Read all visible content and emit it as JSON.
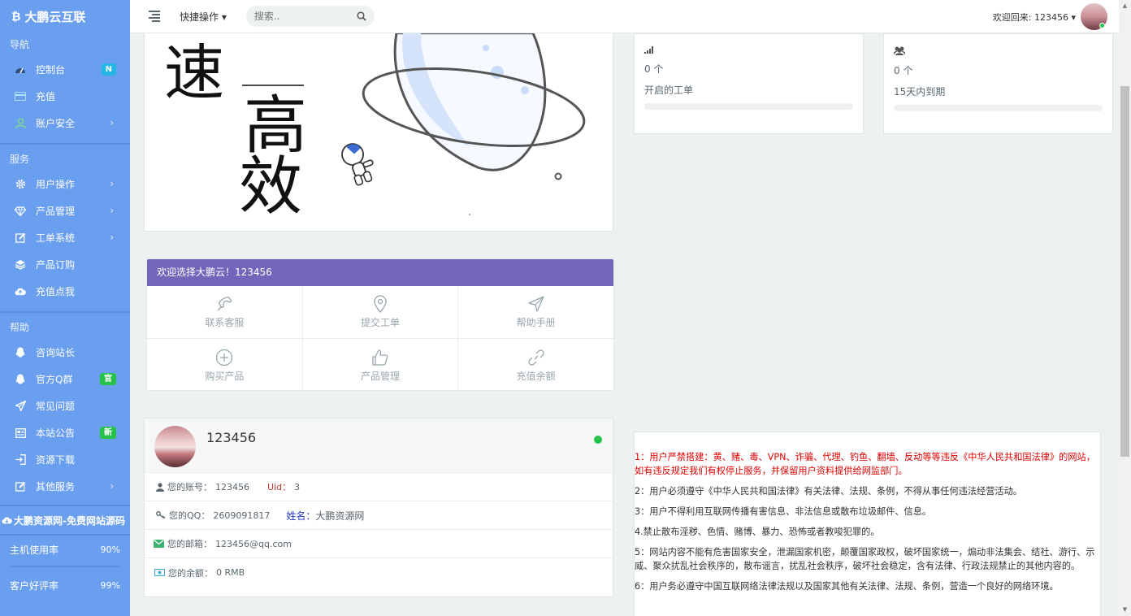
{
  "brand": {
    "logo_icon": "bitcoin-icon",
    "name": "大鹏云互联"
  },
  "sidebar": {
    "sections": [
      {
        "title": "导航",
        "items": [
          {
            "label": "控制台",
            "icon": "dashboard-icon",
            "badge": "N"
          },
          {
            "label": "充值",
            "icon": "card-icon"
          },
          {
            "label": "账户安全",
            "icon": "user-icon",
            "arrow": "›"
          }
        ]
      },
      {
        "title": "服务",
        "items": [
          {
            "label": "用户操作",
            "icon": "gear-icon",
            "arrow": "›"
          },
          {
            "label": "产品管理",
            "icon": "diamond-icon",
            "arrow": "›"
          },
          {
            "label": "工单系统",
            "icon": "edit-icon",
            "arrow": "›"
          },
          {
            "label": "产品订购",
            "icon": "layers-icon"
          },
          {
            "label": "充值点我",
            "icon": "cloud-upload-icon"
          }
        ]
      },
      {
        "title": "帮助",
        "items": [
          {
            "label": "咨询站长",
            "icon": "penguin-icon"
          },
          {
            "label": "官方Q群",
            "icon": "penguin-icon",
            "badge": "官"
          },
          {
            "label": "常见问题",
            "icon": "send-icon"
          },
          {
            "label": "本站公告",
            "icon": "news-icon",
            "badge": "新"
          },
          {
            "label": "资源下载",
            "icon": "sign-in-icon"
          },
          {
            "label": "其他服务",
            "icon": "edit-icon",
            "arrow": "›"
          }
        ]
      }
    ],
    "promo": {
      "label": "大鹏资源网-免费网站源码",
      "icon": "cloud-download-icon"
    },
    "stats": [
      {
        "label": "主机使用率",
        "value": "90%"
      },
      {
        "label": "客户好评率",
        "value": "99%"
      }
    ]
  },
  "header": {
    "quick_ops": "快捷操作 ▾",
    "search_placeholder": "搜索..",
    "welcome": "欢迎回来: 123456 ▾"
  },
  "banner": {
    "chars": [
      "速",
      "高",
      "效"
    ]
  },
  "stat_cards": [
    {
      "icon": "signal-icon",
      "count": "0 个",
      "label": "开启的工单"
    },
    {
      "icon": "users-icon",
      "count": "0 个",
      "label": "15天内到期"
    }
  ],
  "quick_panel": {
    "title": "欢迎选择大鹏云！123456",
    "items": [
      {
        "label": "联系客服",
        "icon": "phone-icon"
      },
      {
        "label": "提交工单",
        "icon": "map-pin-icon"
      },
      {
        "label": "帮助手册",
        "icon": "navigation-icon"
      },
      {
        "label": "购买产品",
        "icon": "plus-circle-icon"
      },
      {
        "label": "产品管理",
        "icon": "thumbs-up-icon"
      },
      {
        "label": "充值余额",
        "icon": "link-icon"
      }
    ]
  },
  "user_card": {
    "name": "123456",
    "account_label": "您的账号：",
    "account": "123456",
    "uid_label": "Uid：",
    "uid": "3",
    "qq_label": "您的QQ：",
    "qq": "2609091817",
    "realname_label": "姓名：",
    "realname": "大鹏资源网",
    "email_label": "您的邮箱：",
    "email": "123456@qq.com",
    "balance_label": "您的余额：",
    "balance": "0 RMB"
  },
  "rules": [
    {
      "text": "1：用户严禁搭建：黄、赌、毒、VPN、诈骗、代理、钓鱼、翻墙、反动等等违反《中华人民共和国法律》的网站，如有违反规定我们有权停止服务，并保留用户资料提供给网监部门。",
      "color": "#e00000"
    },
    {
      "text": "2：用户必须遵守《中华人民共和国法律》有关法律、法规、条例，不得从事任何违法经营活动。"
    },
    {
      "text": "3：用户不得利用互联网传播有害信息、非法信息或散布垃圾邮件、信息。"
    },
    {
      "text": "4.禁止散布淫秽、色情、赌博、暴力、恐怖或者教唆犯罪的。"
    },
    {
      "text": "5：网站内容不能有危害国家安全，泄漏国家机密，颠覆国家政权，破坏国家统一，煽动非法集会、结社、游行、示威、聚众扰乱社会秩序的，散布谣言，扰乱社会秩序，破坏社会稳定，含有法律、行政法规禁止的其他内容的。"
    },
    {
      "text": "6：用户务必遵守中国互联网络法律法规以及国家其他有关法律、法规、条例，营造一个良好的网络环境。"
    }
  ]
}
